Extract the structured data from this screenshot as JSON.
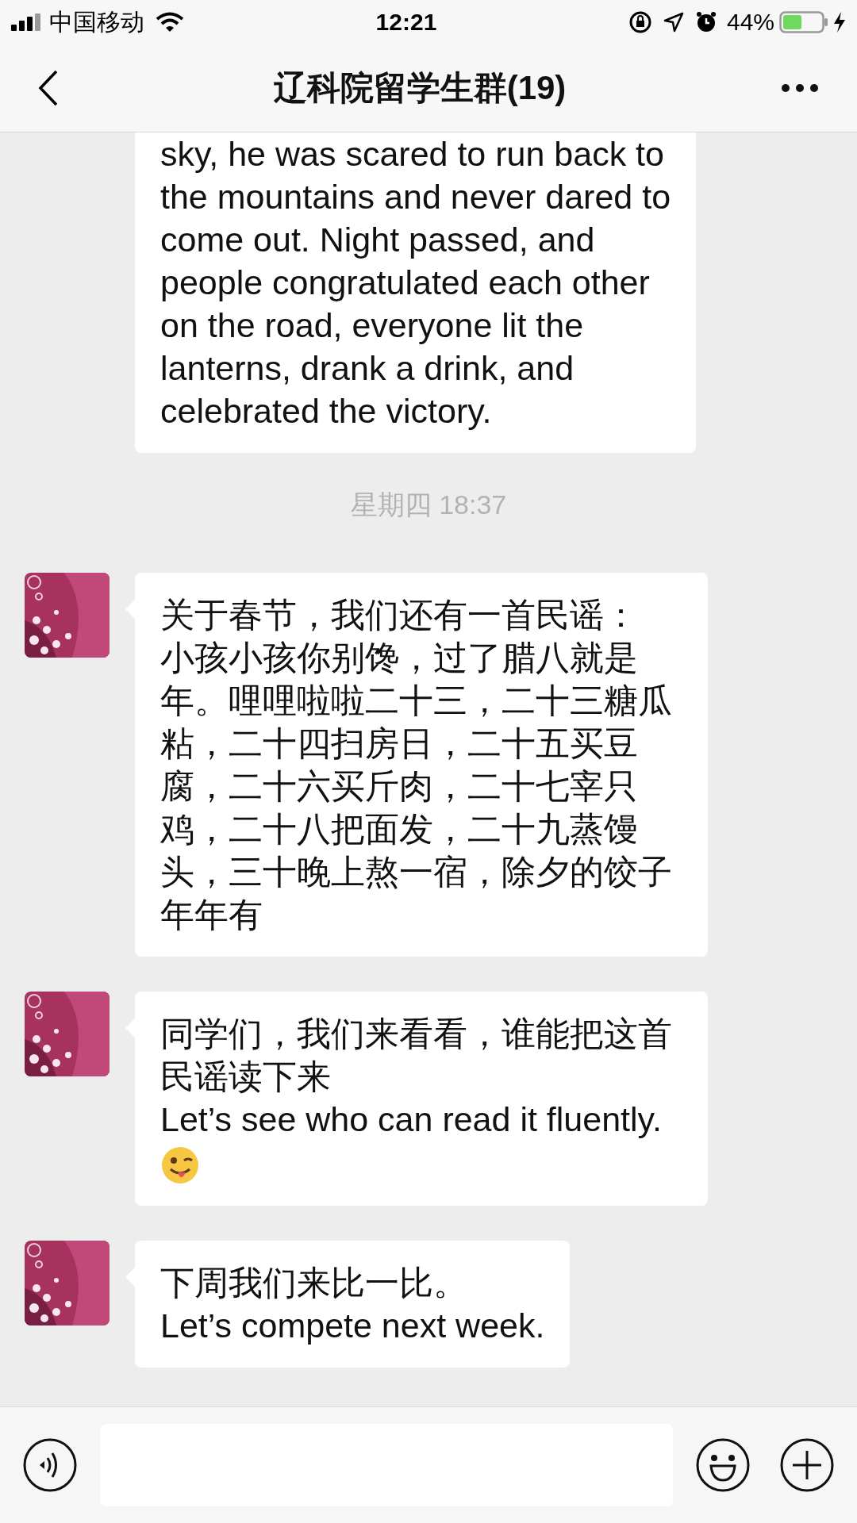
{
  "status_bar": {
    "carrier": "中国移动",
    "time": "12:21",
    "battery": "44%"
  },
  "nav_bar": {
    "title": "辽科院留学生群(19)"
  },
  "messages": [
    {
      "kind": "bubble",
      "avatar": false,
      "top_cut": true,
      "preset_breaks": true,
      "paragraphs": [
        "sky, he was scared to run back to\nthe mountains and never dared to\ncome out. Night passed, and\npeople congratulated each other\non the road, everyone lit the\nlanterns, drank a drink, and\ncelebrated the victory."
      ]
    },
    {
      "kind": "time",
      "text": "星期四 18:37"
    },
    {
      "kind": "bubble",
      "avatar": true,
      "top_cut": false,
      "preset_breaks": false,
      "paragraphs": [
        "关于春节，我们还有一首民谣：",
        "小孩小孩你别馋，过了腊八就是年。哩哩啦啦二十三，二十三糖瓜粘，二十四扫房日，二十五买豆腐，二十六买斤肉，二十七宰只鸡，二十八把面发，二十九蒸馒头，三十晚上熬一宿，除夕的饺子年年有"
      ]
    },
    {
      "kind": "bubble",
      "avatar": true,
      "top_cut": false,
      "preset_breaks": false,
      "emoji": true,
      "paragraphs": [
        "同学们，我们来看看，谁能把这首民谣读下来",
        "Let’s see who can read it fluently."
      ]
    },
    {
      "kind": "bubble",
      "avatar": true,
      "top_cut": false,
      "preset_breaks": false,
      "paragraphs": [
        "下周我们来比一比。",
        "Let’s compete next week."
      ]
    }
  ]
}
